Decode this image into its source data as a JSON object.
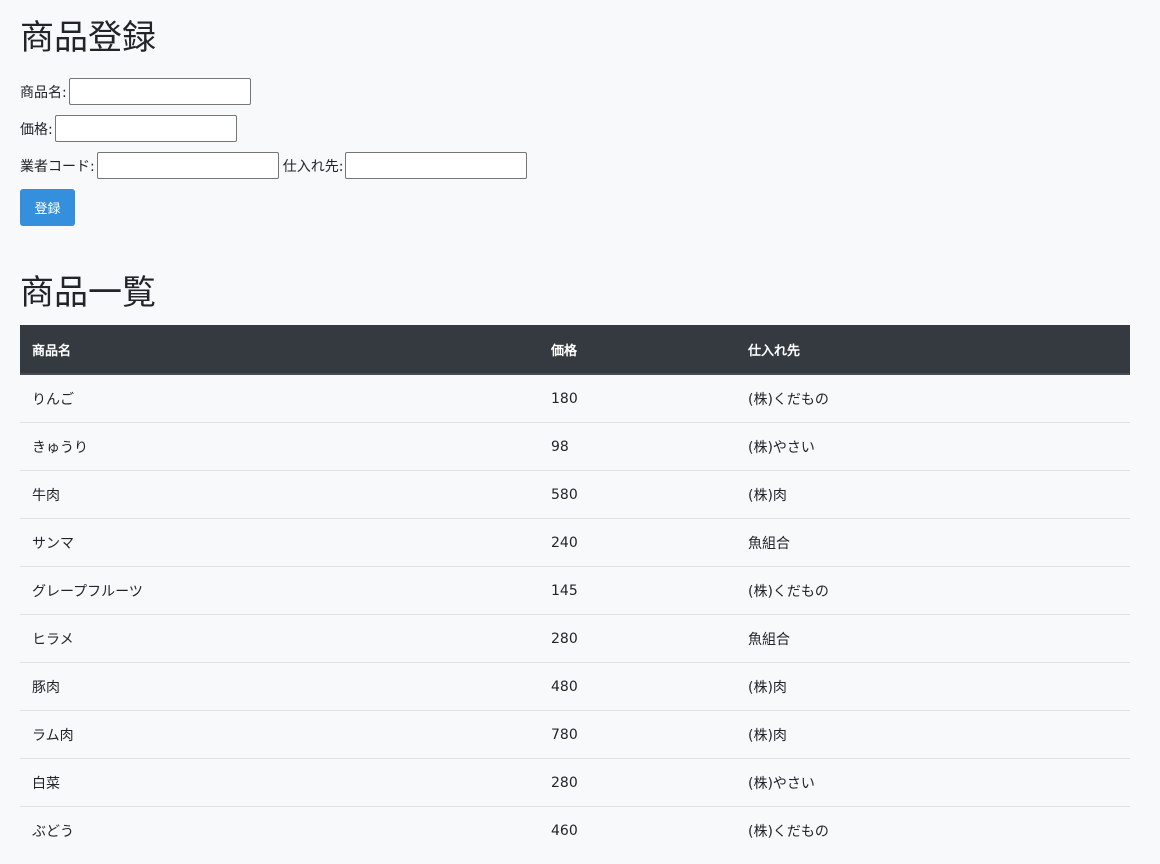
{
  "register": {
    "title": "商品登録",
    "name_label": "商品名:",
    "name_value": "",
    "price_label": "価格:",
    "price_value": "",
    "vendor_code_label": "業者コード:",
    "vendor_code_value": "",
    "supplier_label": "仕入れ先:",
    "supplier_value": "",
    "submit_label": "登録"
  },
  "list": {
    "title": "商品一覧",
    "columns": [
      "商品名",
      "価格",
      "仕入れ先"
    ],
    "rows": [
      {
        "name": "りんご",
        "price": "180",
        "supplier": "(株)くだもの"
      },
      {
        "name": "きゅうり",
        "price": "98",
        "supplier": "(株)やさい"
      },
      {
        "name": "牛肉",
        "price": "580",
        "supplier": "(株)肉"
      },
      {
        "name": "サンマ",
        "price": "240",
        "supplier": "魚組合"
      },
      {
        "name": "グレープフルーツ",
        "price": "145",
        "supplier": "(株)くだもの"
      },
      {
        "name": "ヒラメ",
        "price": "280",
        "supplier": "魚組合"
      },
      {
        "name": "豚肉",
        "price": "480",
        "supplier": "(株)肉"
      },
      {
        "name": "ラム肉",
        "price": "780",
        "supplier": "(株)肉"
      },
      {
        "name": "白菜",
        "price": "280",
        "supplier": "(株)やさい"
      },
      {
        "name": "ぶどう",
        "price": "460",
        "supplier": "(株)くだもの"
      }
    ]
  },
  "colors": {
    "background": "#f8f9fa",
    "table_header_bg": "#343a40",
    "button_bg": "#3490dc"
  }
}
